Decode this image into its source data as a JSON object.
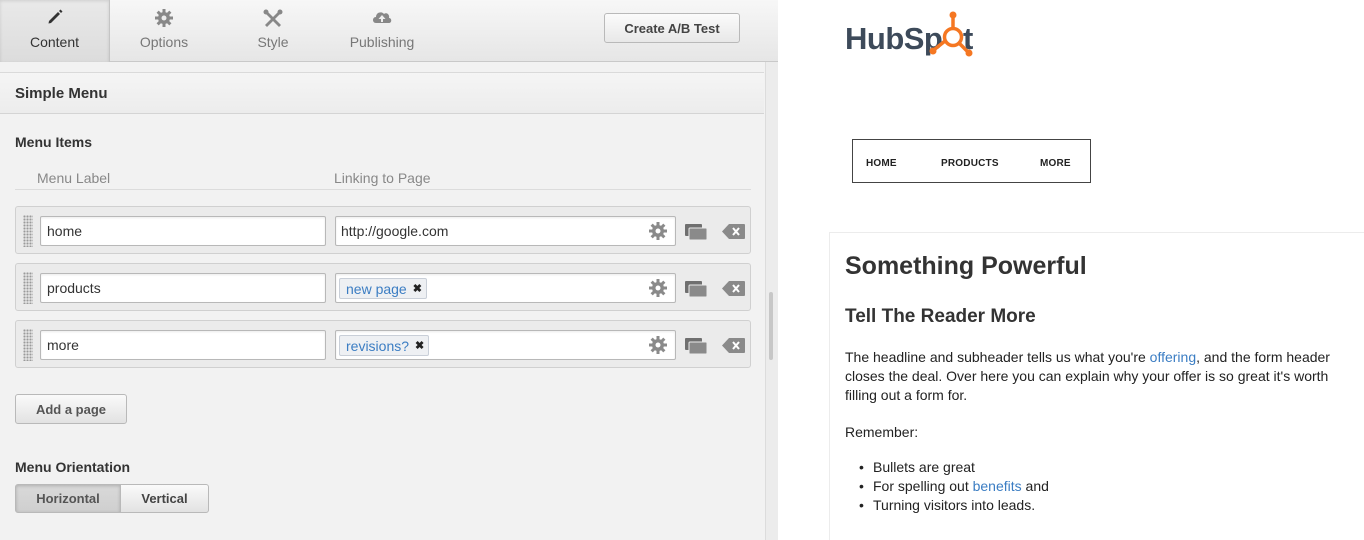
{
  "tabs": [
    {
      "label": "Content",
      "icon": "pencil-icon",
      "active": true
    },
    {
      "label": "Options",
      "icon": "gear-icon",
      "active": false
    },
    {
      "label": "Style",
      "icon": "tools-icon",
      "active": false
    },
    {
      "label": "Publishing",
      "icon": "cloud-upload-icon",
      "active": false
    }
  ],
  "toolbar": {
    "ab_test_label": "Create A/B Test"
  },
  "module": {
    "title": "Simple Menu"
  },
  "menu_items": {
    "section_title": "Menu Items",
    "col_label": "Menu Label",
    "col_link": "Linking to Page",
    "rows": [
      {
        "label": "home",
        "link_text": "http://google.com",
        "chip": ""
      },
      {
        "label": "products",
        "link_text": "",
        "chip": "new page"
      },
      {
        "label": "more",
        "link_text": "",
        "chip": "revisions?"
      }
    ],
    "add_label": "Add a page"
  },
  "orientation": {
    "title": "Menu Orientation",
    "horizontal": "Horizontal",
    "vertical": "Vertical",
    "selected": "Horizontal"
  },
  "preview": {
    "logo_text": "HubSpot",
    "menu": [
      "HOME",
      "PRODUCTS",
      "MORE"
    ],
    "heading": "Something Powerful",
    "subheading": "Tell The Reader More",
    "para_before_link": "The headline and subheader tells us what you're ",
    "para_link": "offering",
    "para_after_link": ", and the form header closes the deal. Over here you can explain why your offer is so great it's worth filling out a form for.",
    "remember": "Remember:",
    "bullet_1": "Bullets are great",
    "bullet_2_before": "For spelling out ",
    "bullet_2_link": "benefits",
    "bullet_2_after": " and",
    "bullet_3": "Turning visitors into leads."
  },
  "colors": {
    "accent_link": "#3b7dc3",
    "hubspot_orange": "#f57722",
    "hubspot_gray": "#3d4a5a"
  }
}
